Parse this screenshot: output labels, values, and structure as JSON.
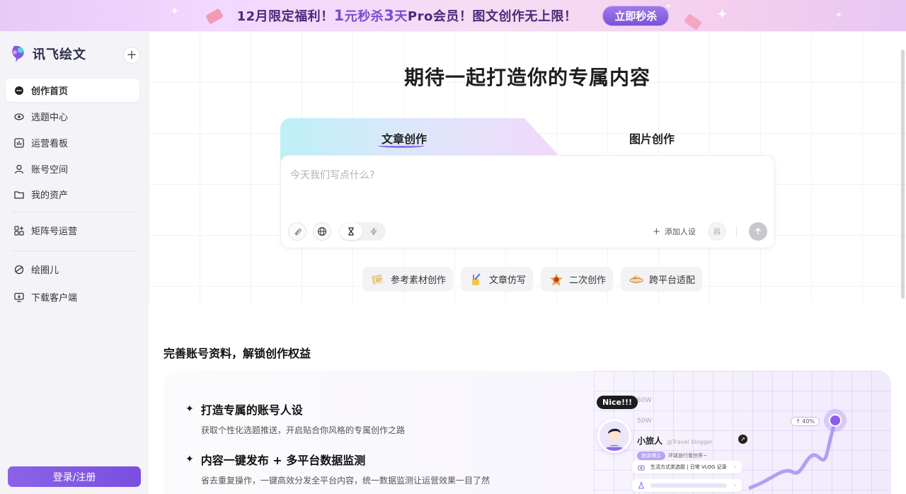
{
  "banner": {
    "text_pre": "12月限定福利！",
    "num1": "1",
    "text_mid1": "元秒杀",
    "num2": "3",
    "text_mid2": "天",
    "text_post": "Pro会员！图文创作无上限！",
    "cta": "立即秒杀"
  },
  "sidebar": {
    "logo_text": "讯飞绘文",
    "new_button": "+",
    "items": [
      {
        "label": "创作首页",
        "icon": "chat-bubble-icon"
      },
      {
        "label": "选题中心",
        "icon": "eye-icon"
      },
      {
        "label": "运营看板",
        "icon": "chart-icon"
      },
      {
        "label": "账号空间",
        "icon": "user-icon"
      },
      {
        "label": "我的资产",
        "icon": "folder-icon"
      },
      {
        "label": "矩阵号运营",
        "icon": "grid-plus-icon"
      },
      {
        "label": "绘圈儿",
        "icon": "orbit-icon"
      },
      {
        "label": "下载客户端",
        "icon": "monitor-download-icon"
      }
    ],
    "login": "登录/注册"
  },
  "main": {
    "title": "期待一起打造你的专属内容",
    "tabs": [
      {
        "label": "文章创作",
        "active": true
      },
      {
        "label": "图片创作",
        "active": false
      }
    ],
    "input_placeholder": "今天我们写点什么?",
    "add_persona": "添加人设",
    "chips": [
      {
        "label": "参考素材创作",
        "icon": "notebook-icon"
      },
      {
        "label": "文章仿写",
        "icon": "pen-cup-icon"
      },
      {
        "label": "二次创作",
        "icon": "star-mascot-icon"
      },
      {
        "label": "跨平台适配",
        "icon": "planet-icon"
      }
    ],
    "section_title": "完善账号资料，解锁创作权益",
    "features": [
      {
        "title": "打造专属的账号人设",
        "desc": "获取个性化选题推送，开启贴合你风格的专属创作之路"
      },
      {
        "title": "内容一键发布 + 多平台数据监测",
        "desc": "省去重复操作，一键高效分发全平台内容，统一数据监测让运营效果一目了然"
      }
    ],
    "illustration": {
      "bubble": "Nice!!!",
      "tick_60w": "60W",
      "tick_50w": "50W",
      "name": "小旅人",
      "handle": "@Travel blogger",
      "tag": "旅游博主",
      "tag_text": "环球旅行看世界~",
      "row1": "生活方式类选题 | 日常 VLOG 记录",
      "badge": "↑ 40%"
    }
  },
  "colors": {
    "accent": "#7a4fe0",
    "banner_bg": "#f3d8ff",
    "sidebar_bg": "#f4f3f8"
  }
}
